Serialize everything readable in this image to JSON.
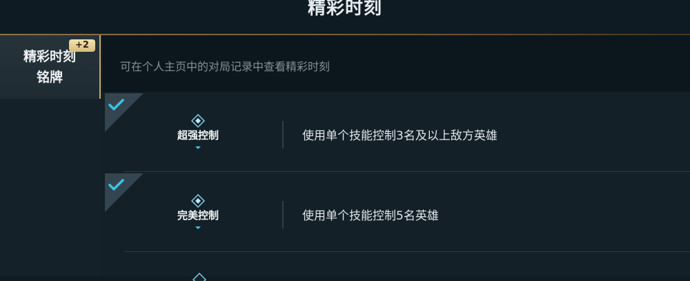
{
  "header": {
    "title": "精彩时刻"
  },
  "sidebar": {
    "tabs": [
      {
        "label": "精彩时刻\n铭牌",
        "badge": "+2"
      }
    ]
  },
  "main": {
    "hint": "可在个人主页中的对局记录中查看精彩时刻",
    "items": [
      {
        "title": "超强控制",
        "description": "使用单个技能控制3名及以上敌方英雄",
        "completed": true
      },
      {
        "title": "完美控制",
        "description": "使用单个技能控制5名英雄",
        "completed": true
      }
    ]
  },
  "colors": {
    "accent_gold": "#c9a864",
    "check_cyan": "#3ec3e8",
    "background": "#101c24"
  }
}
